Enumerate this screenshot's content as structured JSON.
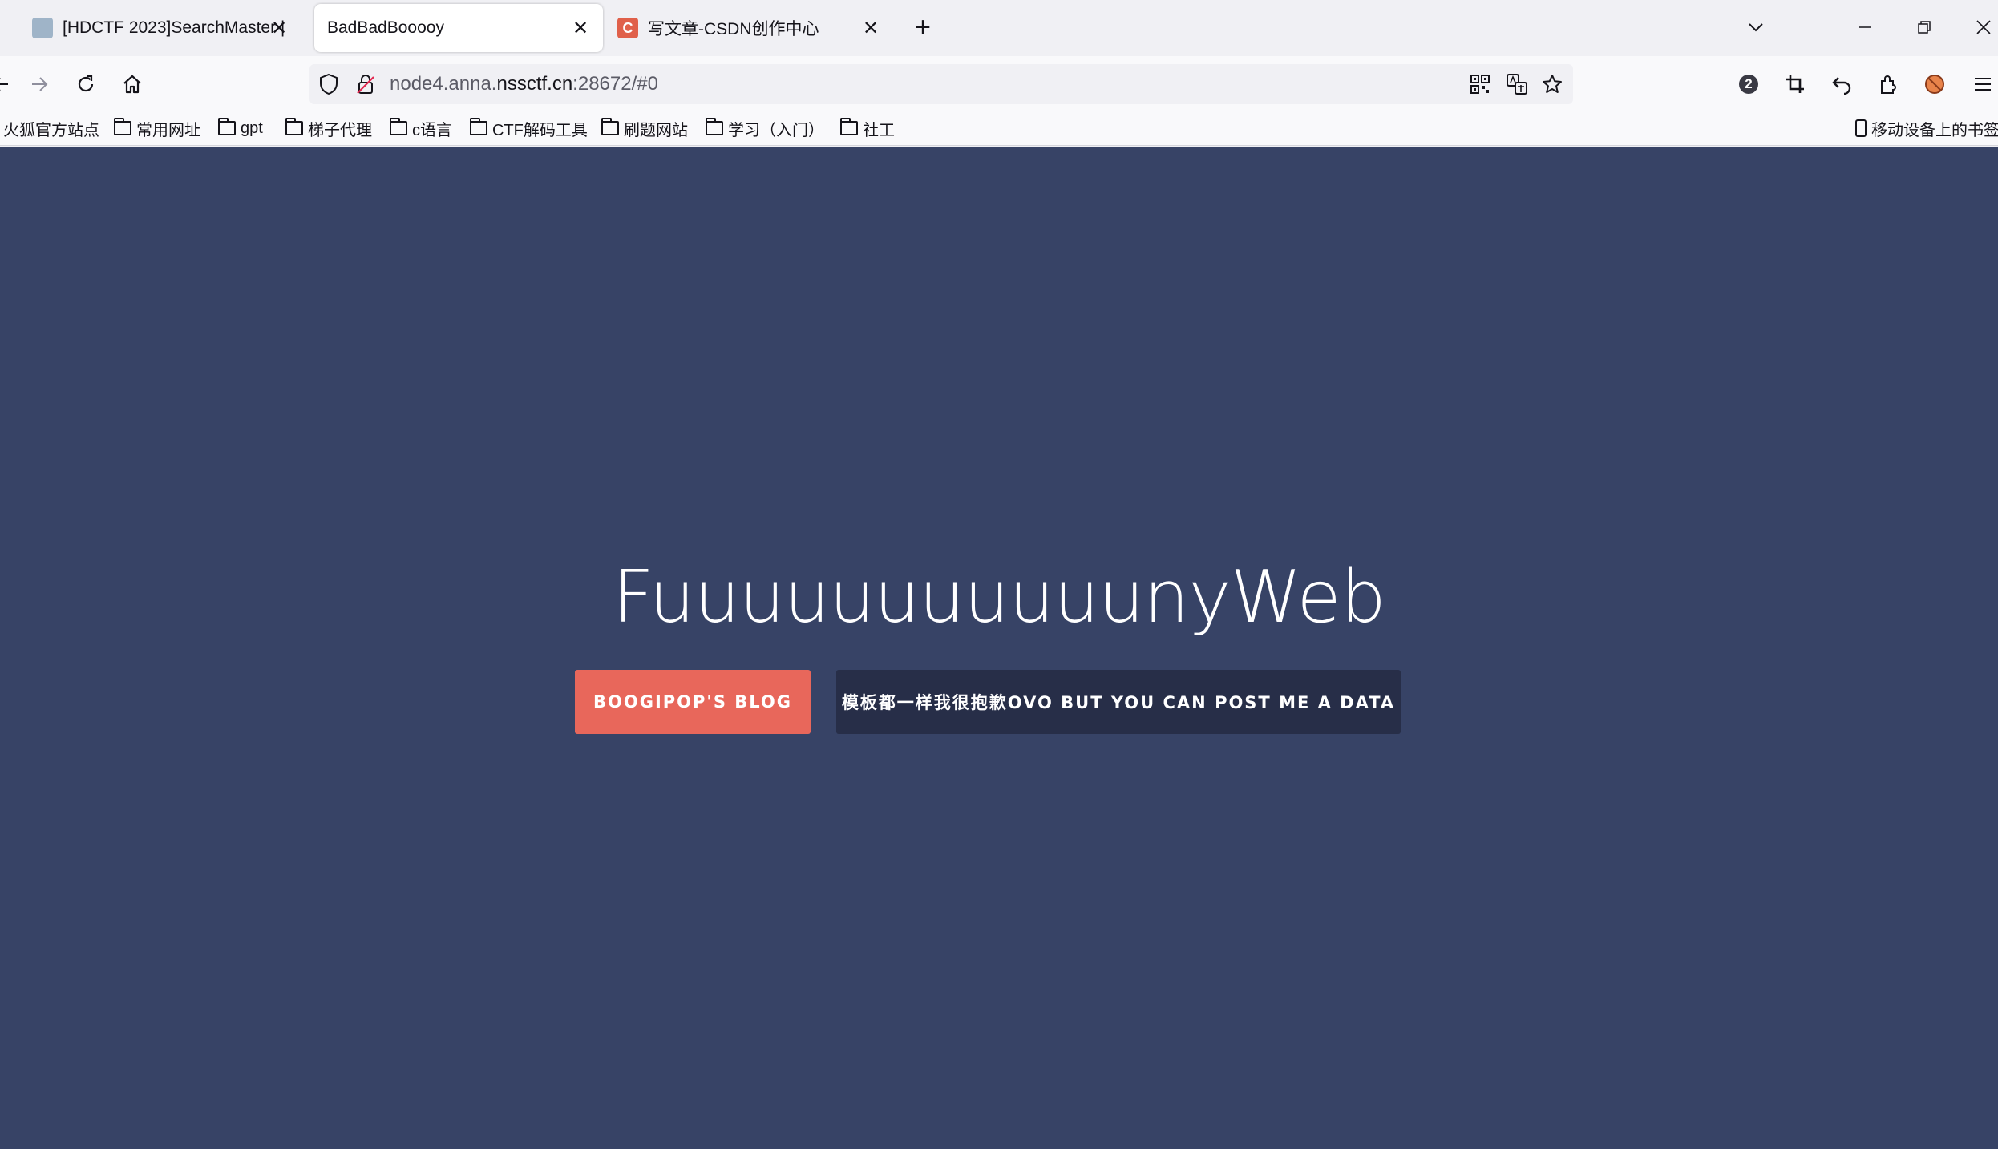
{
  "tabs": [
    {
      "title": "[HDCTF 2023]SearchMaster |",
      "favicon": "doc-icon",
      "active": false
    },
    {
      "title": "BadBadBooooy",
      "favicon": "",
      "active": true
    },
    {
      "title": "写文章-CSDN创作中心",
      "favicon": "csdn-icon",
      "active": false
    }
  ],
  "csdn_favicon_letter": "C",
  "address": {
    "prefix": "node4.anna.",
    "host": "nssctf.cn",
    "suffix": ":28672/#0"
  },
  "extension_badge": "2",
  "bookmarks": [
    {
      "label": "火狐官方站点",
      "folder": false
    },
    {
      "label": "常用网址",
      "folder": true
    },
    {
      "label": "gpt",
      "folder": true
    },
    {
      "label": "梯子代理",
      "folder": true
    },
    {
      "label": "c语言",
      "folder": true
    },
    {
      "label": "CTF解码工具",
      "folder": true
    },
    {
      "label": "刷题网站",
      "folder": true
    },
    {
      "label": "学习（入门）",
      "folder": true
    },
    {
      "label": "社工",
      "folder": true
    }
  ],
  "mobile_bookmarks": "移动设备上的书签",
  "page": {
    "title": "FuuuuuuuuuuunyWeb",
    "blog_button": "BOOGIPOP'S BLOG",
    "data_button": "模板都一样我很抱歉OVO BUT YOU CAN POST ME A DATA"
  },
  "colors": {
    "page_bg": "#374366",
    "blog_button": "#e8675b",
    "data_button": "#272e48"
  }
}
